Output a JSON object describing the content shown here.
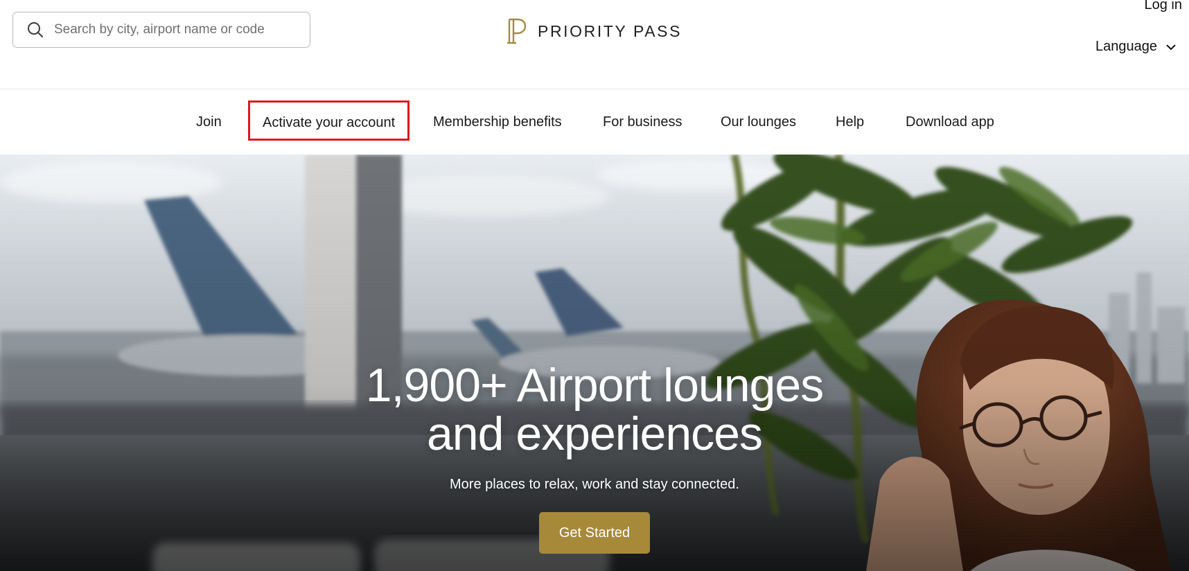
{
  "header": {
    "search": {
      "placeholder": "Search by city, airport name or code",
      "value": ""
    },
    "logo_text": "PRIORITY PASS",
    "login_label": "Log in",
    "language_label": "Language"
  },
  "nav": {
    "items": [
      {
        "label": "Join"
      },
      {
        "label": "Activate your account",
        "highlighted": true
      },
      {
        "label": "Membership benefits"
      },
      {
        "label": "For business"
      },
      {
        "label": "Our lounges"
      },
      {
        "label": "Help"
      },
      {
        "label": "Download app"
      }
    ]
  },
  "hero": {
    "title_line1": "1,900+ Airport lounges",
    "title_line2": "and experiences",
    "subtitle": "More places to relax, work and stay connected.",
    "cta_label": "Get Started"
  },
  "colors": {
    "brand_gold": "#a7893a",
    "highlight_red": "#e4161b",
    "text_dark": "#1a1a1a"
  },
  "icons": [
    "search-icon",
    "chevron-down-icon",
    "priority-pass-logo"
  ]
}
